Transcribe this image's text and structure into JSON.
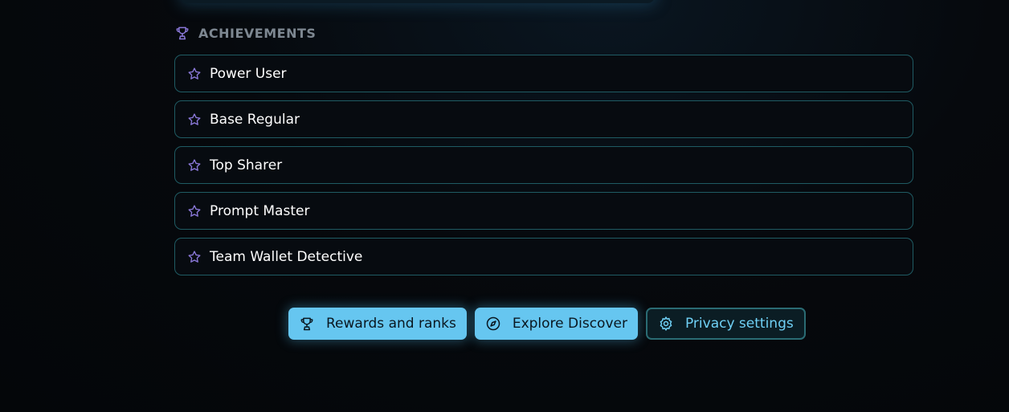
{
  "achievements": {
    "title": "ACHIEVEMENTS",
    "icon": "trophy-icon",
    "items": [
      {
        "label": "Power User",
        "icon": "star-icon"
      },
      {
        "label": "Base Regular",
        "icon": "star-icon"
      },
      {
        "label": "Top Sharer",
        "icon": "star-icon"
      },
      {
        "label": "Prompt Master",
        "icon": "star-icon"
      },
      {
        "label": "Team Wallet Detective",
        "icon": "star-icon"
      }
    ]
  },
  "actions": {
    "rewards": {
      "label": "Rewards and ranks",
      "icon": "trophy-icon"
    },
    "explore": {
      "label": "Explore Discover",
      "icon": "compass-icon"
    },
    "privacy": {
      "label": "Privacy settings",
      "icon": "gear-icon"
    }
  },
  "colors": {
    "accent": "#66c6f0",
    "star": "#8a78d8",
    "border": "#1f5b63",
    "background": "#05080c"
  }
}
